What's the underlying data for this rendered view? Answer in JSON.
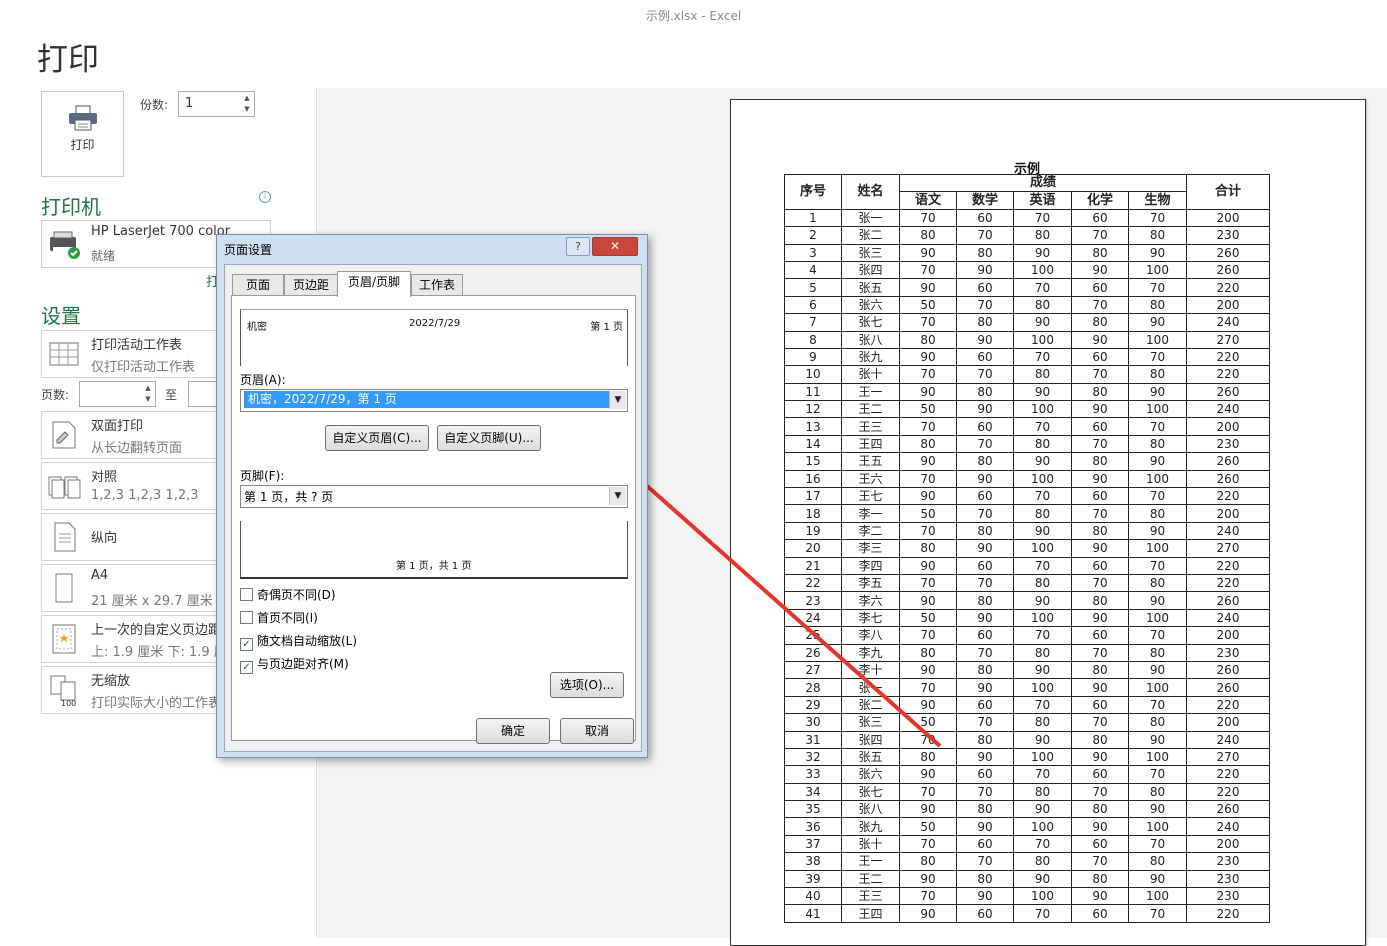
{
  "window": {
    "title": "示例.xlsx  -  Excel"
  },
  "print": {
    "heading": "打印",
    "print_button": "打印",
    "copies_label": "份数:",
    "copies_value": "1"
  },
  "printer": {
    "section_title": "打印机",
    "name": "HP LaserJet 700 color",
    "status": "就绪",
    "properties_link": "打"
  },
  "settings": {
    "section_title": "设置",
    "items": [
      {
        "line1": "打印活动工作表",
        "line2": "仅打印活动工作表"
      },
      {
        "line1": "双面打印",
        "line2": "从长边翻转页面"
      },
      {
        "line1": "对照",
        "line2": "1,2,3    1,2,3    1,2,3"
      },
      {
        "line1": "纵向",
        "line2": ""
      },
      {
        "line1": "A4",
        "line2": "21 厘米 x 29.7 厘米"
      },
      {
        "line1": "上一次的自定义页边距",
        "line2": "上: 1.9 厘米 下: 1.9 厘"
      },
      {
        "line1": "无缩放",
        "line2": "打印实际大小的工作表"
      }
    ],
    "pages_label": "页数:",
    "pages_to_label": "至"
  },
  "dialog": {
    "title": "页面设置",
    "help": "?",
    "close": "✕",
    "tabs": [
      "页面",
      "页边距",
      "页眉/页脚",
      "工作表"
    ],
    "header_preview": {
      "left": "机密",
      "center": "2022/7/29",
      "right": "第 1 页"
    },
    "header_label": "页眉(A):",
    "header_value": "机密，2022/7/29，第 1 页",
    "custom_header_button": "自定义页眉(C)...",
    "custom_footer_button": "自定义页脚(U)...",
    "footer_label": "页脚(F):",
    "footer_value": "第 1 页，共 ? 页",
    "footer_preview": "第 1 页，共 1 页",
    "checkboxes": [
      {
        "label": "奇偶页不同(D)",
        "checked": ""
      },
      {
        "label": "首页不同(I)",
        "checked": ""
      },
      {
        "label": "随文档自动缩放(L)",
        "checked": "✓"
      },
      {
        "label": "与页边距对齐(M)",
        "checked": "✓"
      }
    ],
    "options_button": "选项(O)...",
    "ok_button": "确定",
    "cancel_button": "取消"
  },
  "sheet": {
    "title": "示例",
    "headers": {
      "seq": "序号",
      "name": "姓名",
      "scores": "成绩",
      "total": "合计",
      "subjects": [
        "语文",
        "数学",
        "英语",
        "化学",
        "生物"
      ]
    },
    "rows": [
      [
        "1",
        "张一",
        "70",
        "60",
        "70",
        "60",
        "70",
        "200"
      ],
      [
        "2",
        "张二",
        "80",
        "70",
        "80",
        "70",
        "80",
        "230"
      ],
      [
        "3",
        "张三",
        "90",
        "80",
        "90",
        "80",
        "90",
        "260"
      ],
      [
        "4",
        "张四",
        "70",
        "90",
        "100",
        "90",
        "100",
        "260"
      ],
      [
        "5",
        "张五",
        "90",
        "60",
        "70",
        "60",
        "70",
        "220"
      ],
      [
        "6",
        "张六",
        "50",
        "70",
        "80",
        "70",
        "80",
        "200"
      ],
      [
        "7",
        "张七",
        "70",
        "80",
        "90",
        "80",
        "90",
        "240"
      ],
      [
        "8",
        "张八",
        "80",
        "90",
        "100",
        "90",
        "100",
        "270"
      ],
      [
        "9",
        "张九",
        "90",
        "60",
        "70",
        "60",
        "70",
        "220"
      ],
      [
        "10",
        "张十",
        "70",
        "70",
        "80",
        "70",
        "80",
        "220"
      ],
      [
        "11",
        "王一",
        "90",
        "80",
        "90",
        "80",
        "90",
        "260"
      ],
      [
        "12",
        "王二",
        "50",
        "90",
        "100",
        "90",
        "100",
        "240"
      ],
      [
        "13",
        "王三",
        "70",
        "60",
        "70",
        "60",
        "70",
        "200"
      ],
      [
        "14",
        "王四",
        "80",
        "70",
        "80",
        "70",
        "80",
        "230"
      ],
      [
        "15",
        "王五",
        "90",
        "80",
        "90",
        "80",
        "90",
        "260"
      ],
      [
        "16",
        "王六",
        "70",
        "90",
        "100",
        "90",
        "100",
        "260"
      ],
      [
        "17",
        "王七",
        "90",
        "60",
        "70",
        "60",
        "70",
        "220"
      ],
      [
        "18",
        "李一",
        "50",
        "70",
        "80",
        "70",
        "80",
        "200"
      ],
      [
        "19",
        "李二",
        "70",
        "80",
        "90",
        "80",
        "90",
        "240"
      ],
      [
        "20",
        "李三",
        "80",
        "90",
        "100",
        "90",
        "100",
        "270"
      ],
      [
        "21",
        "李四",
        "90",
        "60",
        "70",
        "60",
        "70",
        "220"
      ],
      [
        "22",
        "李五",
        "70",
        "70",
        "80",
        "70",
        "80",
        "220"
      ],
      [
        "23",
        "李六",
        "90",
        "80",
        "90",
        "80",
        "90",
        "260"
      ],
      [
        "24",
        "李七",
        "50",
        "90",
        "100",
        "90",
        "100",
        "240"
      ],
      [
        "25",
        "李八",
        "70",
        "60",
        "70",
        "60",
        "70",
        "200"
      ],
      [
        "26",
        "李九",
        "80",
        "70",
        "80",
        "70",
        "80",
        "230"
      ],
      [
        "27",
        "李十",
        "90",
        "80",
        "90",
        "80",
        "90",
        "260"
      ],
      [
        "28",
        "张一",
        "70",
        "90",
        "100",
        "90",
        "100",
        "260"
      ],
      [
        "29",
        "张二",
        "90",
        "60",
        "70",
        "60",
        "70",
        "220"
      ],
      [
        "30",
        "张三",
        "50",
        "70",
        "80",
        "70",
        "80",
        "200"
      ],
      [
        "31",
        "张四",
        "70",
        "80",
        "90",
        "80",
        "90",
        "240"
      ],
      [
        "32",
        "张五",
        "80",
        "90",
        "100",
        "90",
        "100",
        "270"
      ],
      [
        "33",
        "张六",
        "90",
        "60",
        "70",
        "60",
        "70",
        "220"
      ],
      [
        "34",
        "张七",
        "70",
        "70",
        "80",
        "70",
        "80",
        "220"
      ],
      [
        "35",
        "张八",
        "90",
        "80",
        "90",
        "80",
        "90",
        "260"
      ],
      [
        "36",
        "张九",
        "50",
        "90",
        "100",
        "90",
        "100",
        "240"
      ],
      [
        "37",
        "张十",
        "70",
        "60",
        "70",
        "60",
        "70",
        "200"
      ],
      [
        "38",
        "王一",
        "80",
        "70",
        "80",
        "70",
        "80",
        "230"
      ],
      [
        "39",
        "王二",
        "90",
        "80",
        "90",
        "80",
        "90",
        "230"
      ],
      [
        "40",
        "王三",
        "70",
        "90",
        "100",
        "90",
        "100",
        "230"
      ],
      [
        "41",
        "王四",
        "90",
        "60",
        "70",
        "60",
        "70",
        "220"
      ]
    ]
  },
  "colors": {
    "accent": "#217346",
    "arrow": "#e8322b",
    "selection": "#3399ff"
  }
}
